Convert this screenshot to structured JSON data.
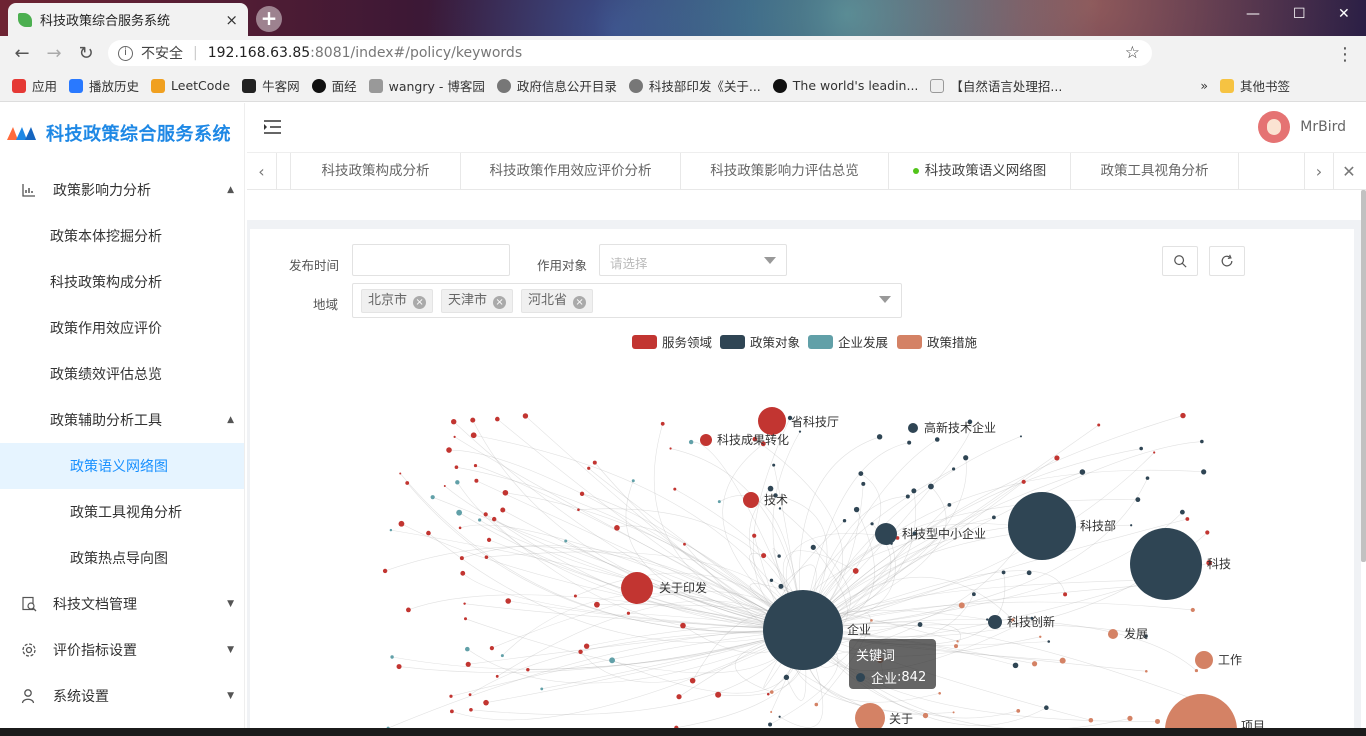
{
  "browser": {
    "tab_title": "科技政策综合服务系统",
    "tab_close": "×",
    "new_tab": "+",
    "url_security": "不安全",
    "url_host": "192.168.63.85",
    "url_path": ":8081/index#/policy/keywords",
    "bookmarks": [
      "应用",
      "播放历史",
      "LeetCode",
      "牛客网",
      "面经",
      "wangry - 博客园",
      "政府信息公开目录",
      "科技部印发《关于...",
      "The world's leadin...",
      "【自然语言处理招..."
    ],
    "bookmarks_more": "»",
    "other_bookmarks": "其他书签"
  },
  "app": {
    "title": "科技政策综合服务系统",
    "username": "MrBird"
  },
  "sidebar": {
    "items": [
      {
        "label": "政策影响力分析",
        "icon": "chart-icon",
        "expanded": true
      },
      {
        "label": "政策本体挖掘分析"
      },
      {
        "label": "科技政策构成分析"
      },
      {
        "label": "政策作用效应评价"
      },
      {
        "label": "政策绩效评估总览"
      },
      {
        "label": "政策辅助分析工具",
        "expanded": true
      },
      {
        "label": "政策语义网络图",
        "active": true
      },
      {
        "label": "政策工具视角分析"
      },
      {
        "label": "政策热点导向图"
      },
      {
        "label": "科技文档管理",
        "icon": "doc-search-icon"
      },
      {
        "label": "评价指标设置",
        "icon": "gear-icon"
      },
      {
        "label": "系统设置",
        "icon": "user-icon"
      }
    ]
  },
  "page_tabs": [
    {
      "label": "科技政策构成分析"
    },
    {
      "label": "科技政策作用效应评价分析"
    },
    {
      "label": "科技政策影响力评估总览"
    },
    {
      "label": "科技政策语义网络图",
      "active": true
    },
    {
      "label": "政策工具视角分析"
    }
  ],
  "filters": {
    "publish_time_label": "发布时间",
    "publish_time_value": "",
    "target_label": "作用对象",
    "target_placeholder": "请选择",
    "region_label": "地域",
    "region_tags": [
      "北京市",
      "天津市",
      "河北省"
    ]
  },
  "legend": [
    {
      "name": "服务领域",
      "color": "#c23531"
    },
    {
      "name": "政策对象",
      "color": "#2f4554"
    },
    {
      "name": "企业发展",
      "color": "#61a0a8"
    },
    {
      "name": "政策措施",
      "color": "#d48265"
    }
  ],
  "graph_labels": {
    "shengkejiting": "省科技厅",
    "chengguo": "科技成果转化",
    "gaoxin": "高新技术企业",
    "jishu": "技术",
    "zhongxiao": "科技型中小企业",
    "kejibu": "科技部",
    "keji": "科技",
    "guanyuyinfa": "关于印发",
    "qiye": "企业",
    "chuangxin": "科技创新",
    "fazhan": "发展",
    "gongzuo": "工作",
    "guanyu": "关于",
    "xiangmu": "项目"
  },
  "tooltip": {
    "title": "关键词",
    "name": "企业",
    "value": "842"
  }
}
